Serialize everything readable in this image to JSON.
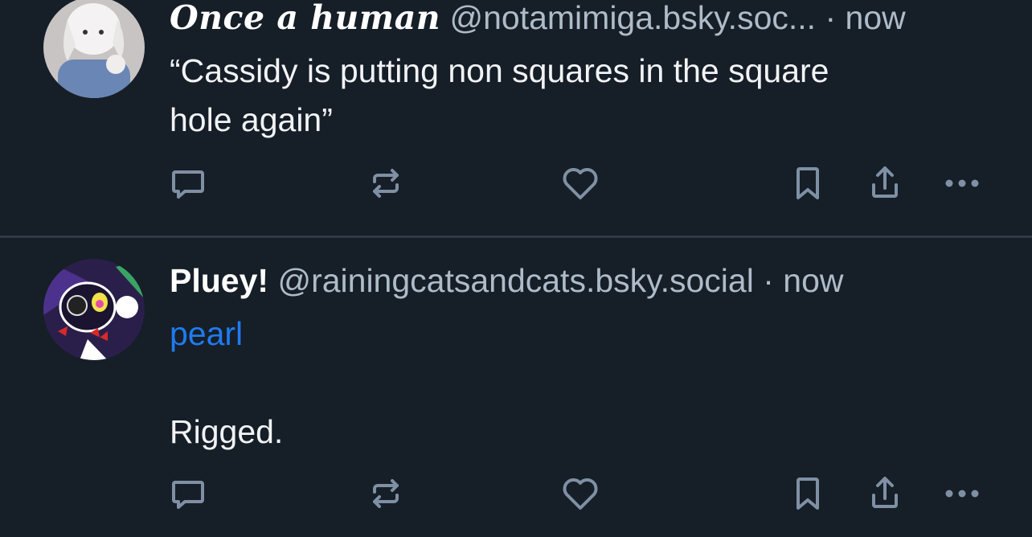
{
  "feed": {
    "posts": [
      {
        "display_name": "𝑶𝒏𝒄𝒆 𝒂 𝒉𝒖𝒎𝒂𝒏",
        "handle": "@notamimiga.bsky.soc...",
        "separator": "·",
        "time": "now",
        "text_lines": [
          "“Cassidy is putting non squares in the square",
          "hole again”"
        ],
        "actions": [
          "reply-icon",
          "repost-icon",
          "like-icon",
          "bookmark-icon",
          "share-icon",
          "more-icon"
        ]
      },
      {
        "display_name": "Pluey!",
        "handle": "@rainingcatsandcats.bsky.social",
        "separator": "·",
        "time": "now",
        "link_text": "pearl",
        "body_text": "Rigged.",
        "actions": [
          "reply-icon",
          "repost-icon",
          "like-icon",
          "bookmark-icon",
          "share-icon",
          "more-icon"
        ]
      }
    ]
  },
  "colors": {
    "background": "#161e27",
    "divider": "#2e3a48",
    "muted": "#aebbc9",
    "link": "#1f7bef",
    "icon": "#7f90a4"
  }
}
